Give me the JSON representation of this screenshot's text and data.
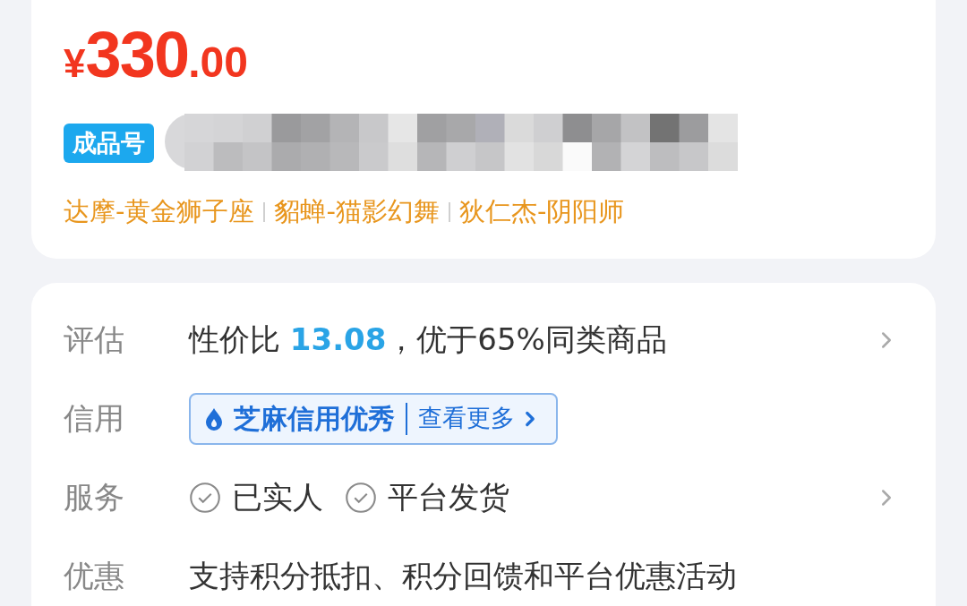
{
  "price": {
    "currency": "¥",
    "integer": "330",
    "decimal": ".00"
  },
  "tag": "成品号",
  "skins": [
    "达摩-黄金狮子座",
    "貂蝉-猫影幻舞",
    "狄仁杰-阴阳师"
  ],
  "rows": [
    {
      "kind": "value",
      "label": "评估",
      "prefix": "性价比 ",
      "highlight": "13.08",
      "suffix": "，优于65%同类商品",
      "arrow": true
    },
    {
      "kind": "credit",
      "label": "信用",
      "badge": "芝麻信用优秀",
      "link": "查看更多"
    },
    {
      "kind": "checks",
      "label": "服务",
      "items": [
        "已实人",
        "平台发货"
      ],
      "arrow": true
    },
    {
      "kind": "text",
      "label": "优惠",
      "text": "支持积分抵扣、积分回馈和平台优惠活动",
      "arrow": false
    }
  ]
}
